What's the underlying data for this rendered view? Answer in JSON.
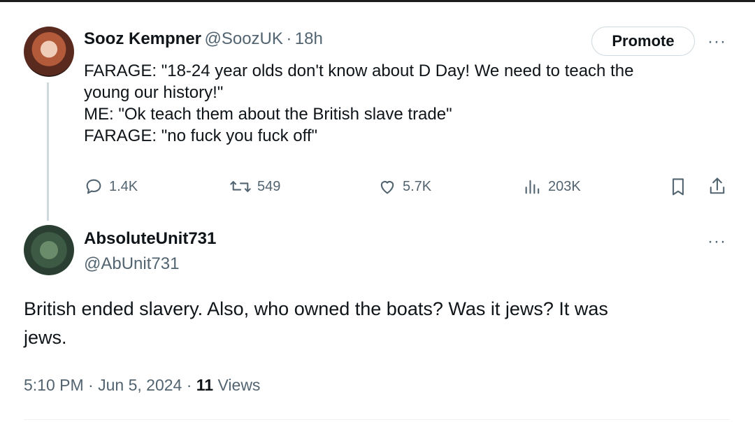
{
  "tweet": {
    "author_name": "Sooz Kempner",
    "author_handle": "@SoozUK",
    "separator": "·",
    "time": "18h",
    "promote_label": "Promote",
    "more_label": "···",
    "lines": [
      "FARAGE: \"18-24 year olds don't know about D Day! We need to teach the",
      "young our history!\"",
      "ME: \"Ok teach them about the British slave trade\"",
      "FARAGE: \"no fuck you fuck off\""
    ],
    "stats": {
      "replies": "1.4K",
      "reposts": "549",
      "likes": "5.7K",
      "views": "203K"
    },
    "icons": [
      "reply-icon",
      "repost-icon",
      "like-icon",
      "views-icon",
      "bookmark-icon",
      "share-icon"
    ]
  },
  "reply": {
    "author_name": "AbsoluteUnit731",
    "author_handle": "@AbUnit731",
    "more_label": "···",
    "lines": [
      "British ended slavery. Also, who owned the boats? Was it jews? It was",
      "jews."
    ],
    "time": "5:10 PM",
    "separator": "·",
    "date": "Jun 5, 2024",
    "views_count": "11",
    "views_label": "Views"
  },
  "colors": {
    "text": "#0f1419",
    "secondary": "#536471",
    "border": "#cfd9de"
  }
}
